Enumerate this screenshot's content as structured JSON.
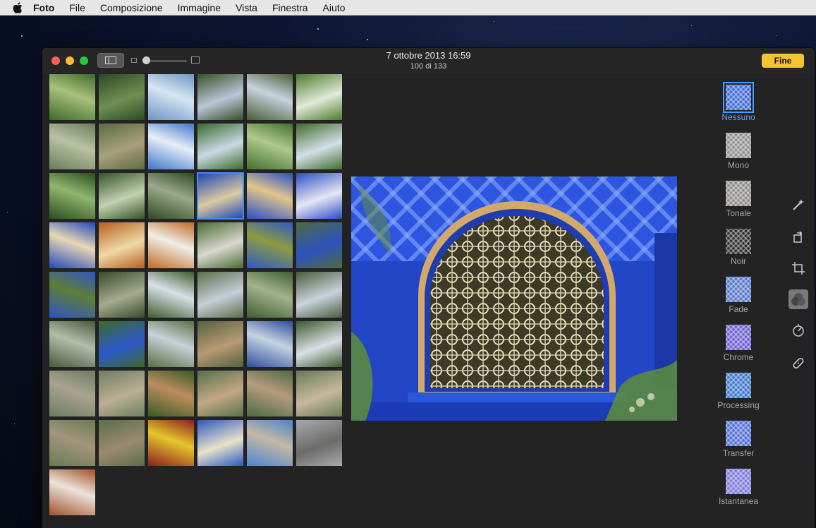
{
  "menubar": {
    "items": [
      "Foto",
      "File",
      "Composizione",
      "Immagine",
      "Vista",
      "Finestra",
      "Aiuto"
    ]
  },
  "titlebar": {
    "date": "7 ottobre 2013 16:59",
    "count": "100 di 133",
    "done_label": "Fine"
  },
  "thumbnails": [
    [
      "#3f6a2b",
      "#a8c07a"
    ],
    [
      "#2b4a24",
      "#6f8f55"
    ],
    [
      "#6f95c6",
      "#d7e5f2"
    ],
    [
      "#3a4f2a",
      "#b8c6d6"
    ],
    [
      "#4a5d3a",
      "#c6d3de"
    ],
    [
      "#4e7a2e",
      "#e1ead8"
    ],
    [
      "#6b7d5a",
      "#b9c2a4"
    ],
    [
      "#5c6b43",
      "#a89f7d"
    ],
    [
      "#3f76c9",
      "#e7eef7"
    ],
    [
      "#3b6a2b",
      "#c9d9e3"
    ],
    [
      "#43702d",
      "#aec98a"
    ],
    [
      "#416c2b",
      "#d2dfe7"
    ],
    [
      "#2c4d1e",
      "#8fb66f"
    ],
    [
      "#35542a",
      "#c2d1b0"
    ],
    [
      "#2f4a22",
      "#9aa88a"
    ],
    [
      "#1d43b5",
      "#d8cba1"
    ],
    [
      "#2a4fc9",
      "#e0c58a"
    ],
    [
      "#2d4cc6",
      "#e4e7f2"
    ],
    [
      "#2148b8",
      "#e8d7b5"
    ],
    [
      "#b85f1f",
      "#eed9a6"
    ],
    [
      "#c06a25",
      "#f0ede6"
    ],
    [
      "#4b6b33",
      "#d9d7cf"
    ],
    [
      "#2e59c2",
      "#8c9b42"
    ],
    [
      "#4d6b3c",
      "#2e53c0"
    ],
    [
      "#2e55c4",
      "#5f7e38"
    ],
    [
      "#3b4a2f",
      "#a3ac8c"
    ],
    [
      "#3f5e2e",
      "#d8dfe8"
    ],
    [
      "#5d6f4a",
      "#c6ced8"
    ],
    [
      "#3f5f33",
      "#a4b28c"
    ],
    [
      "#4b5c3b",
      "#c9d2dc"
    ],
    [
      "#495b3c",
      "#b4bcaa"
    ],
    [
      "#3d6a2a",
      "#2c59c9"
    ],
    [
      "#5c7042",
      "#c8d0da"
    ],
    [
      "#56623e",
      "#b89a74"
    ],
    [
      "#2f4e9a",
      "#c4d2e2"
    ],
    [
      "#3f5a2e",
      "#d9dfe6"
    ],
    [
      "#6c7d62",
      "#a9a38e"
    ],
    [
      "#6b7f64",
      "#bcae92"
    ],
    [
      "#3b5a26",
      "#bb8d5f"
    ],
    [
      "#57714a",
      "#c2a784"
    ],
    [
      "#4e6a42",
      "#b39c7e"
    ],
    [
      "#667a5a",
      "#c8b89b"
    ],
    [
      "#6c7a57",
      "#a2957a"
    ],
    [
      "#5a6e4c",
      "#9b8a70"
    ],
    [
      "#8a1f1f",
      "#e6c62c"
    ],
    [
      "#2d58c1",
      "#e7e2c9"
    ],
    [
      "#4f83cf",
      "#c4b8a6"
    ],
    [
      "#a7a9ad",
      "#6c6b68"
    ],
    [
      "#a2512a",
      "#ece3da"
    ]
  ],
  "selected_index": 15,
  "filters": [
    {
      "label": "Nessuno",
      "color": "#3f69d8"
    },
    {
      "label": "Mono",
      "color": "#8f8f8f"
    },
    {
      "label": "Tonale",
      "color": "#8d8a84"
    },
    {
      "label": "Noir",
      "color": "#2b2b2b"
    },
    {
      "label": "Fade",
      "color": "#5676c8"
    },
    {
      "label": "Chrome",
      "color": "#6a5fd0"
    },
    {
      "label": "Processing",
      "color": "#3c77c9"
    },
    {
      "label": "Transfer",
      "color": "#4d6fd2"
    },
    {
      "label": "Istantanea",
      "color": "#7b7ad8"
    }
  ],
  "active_filter": "Nessuno",
  "tools": [
    "magic-wand-icon",
    "rotate-icon",
    "crop-icon",
    "filters-icon",
    "adjust-icon",
    "retouch-icon"
  ],
  "active_tool": "filters-icon"
}
